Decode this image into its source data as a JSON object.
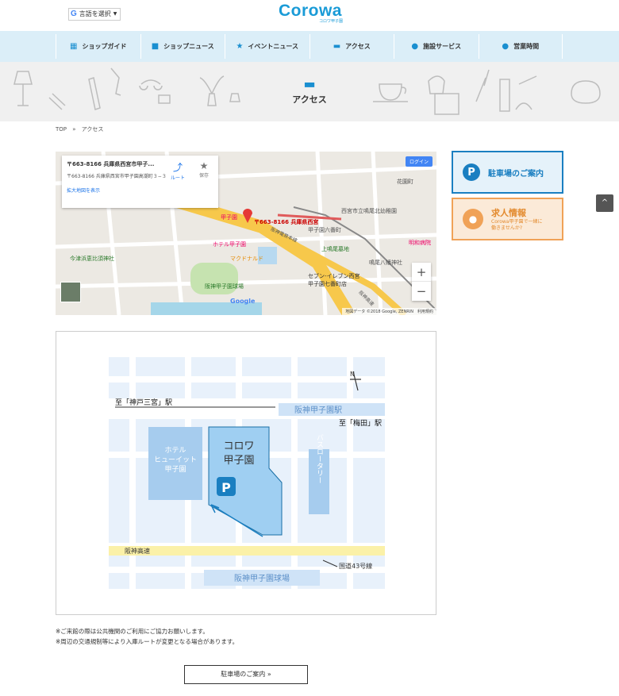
{
  "header": {
    "language_label": "言語を選択",
    "language_g": "G",
    "logo_text": "Corowa",
    "logo_sub": "コロワ甲子園"
  },
  "nav": [
    {
      "label": "ショップガイド",
      "icon": "map-icon"
    },
    {
      "label": "ショップニュース",
      "icon": "bag-icon"
    },
    {
      "label": "イベントニュース",
      "icon": "star-icon"
    },
    {
      "label": "アクセス",
      "icon": "car-icon"
    },
    {
      "label": "施設サービス",
      "icon": "heart-icon"
    },
    {
      "label": "営業時間",
      "icon": "check-icon"
    }
  ],
  "hero": {
    "title": "アクセス"
  },
  "breadcrumb": {
    "home": "TOP",
    "sep": "»",
    "current": "アクセス"
  },
  "map": {
    "card_title": "〒663-8166 兵庫県西宮市甲子...",
    "card_address": "〒663-8166 兵庫県西宮市甲子園高潮町３−３",
    "card_link": "拡大地図を表示",
    "route_label": "ルート",
    "save_label": "保存",
    "login_label": "ログイン",
    "zoom_in": "+",
    "zoom_out": "−",
    "footer": "地図データ ©2018 Google, ZENRIN　利用規約",
    "marker_label": "〒663-8166 兵庫県西宮",
    "labels": {
      "koshien": "甲子園",
      "hotel": "ホテル甲子園",
      "mcd": "マクドナルド",
      "stadium": "阪神甲子園球場",
      "seven": "セブン-イレブン西宮甲子園七番町店",
      "nishinomiya": "西宮市立鳴尾北幼稚園",
      "hanshin_line": "阪神電鉄本線",
      "hanshin_exp": "阪神高速",
      "ima": "今津浜恵比須神社",
      "meiwa": "明和病院",
      "narumi": "鳴尾八幡神社",
      "kamiyama": "上鳴尾墓地",
      "koshien_roku": "甲子園六番町",
      "hanazono": "花園町",
      "google": "Google"
    }
  },
  "side": {
    "parking_label": "駐車場のご案内",
    "parking_icon": "P",
    "jobs_label": "求人情報",
    "jobs_sub1": "Corowa甲子園で一緒に",
    "jobs_sub2": "働きませんか?",
    "top_arrow": "^"
  },
  "route_map": {
    "to_sannomiya": "至「神戸三宮」駅",
    "to_umeda": "至「梅田」駅",
    "station": "阪神甲子園駅",
    "hotel": "ホテル\nヒューイット\n甲子園",
    "corowa": "コロワ\n甲子園",
    "bus": "バスロータリー",
    "expressway": "阪神高速",
    "route43": "国道43号線",
    "stadium": "阪神甲子園球場",
    "parking": "P",
    "north": "N"
  },
  "notes": [
    "※ご来館の際は公共機関のご利用にご協力お願いします。",
    "※周辺の交通規制等により入庫ルートが変更となる場合があります。"
  ],
  "bottom_button": "駐車場のご案内 »",
  "colors": {
    "accent": "#1a8fd0",
    "nav_bg": "#dbeef8",
    "parking": "#1a7fc1",
    "jobs": "#f0a257"
  }
}
